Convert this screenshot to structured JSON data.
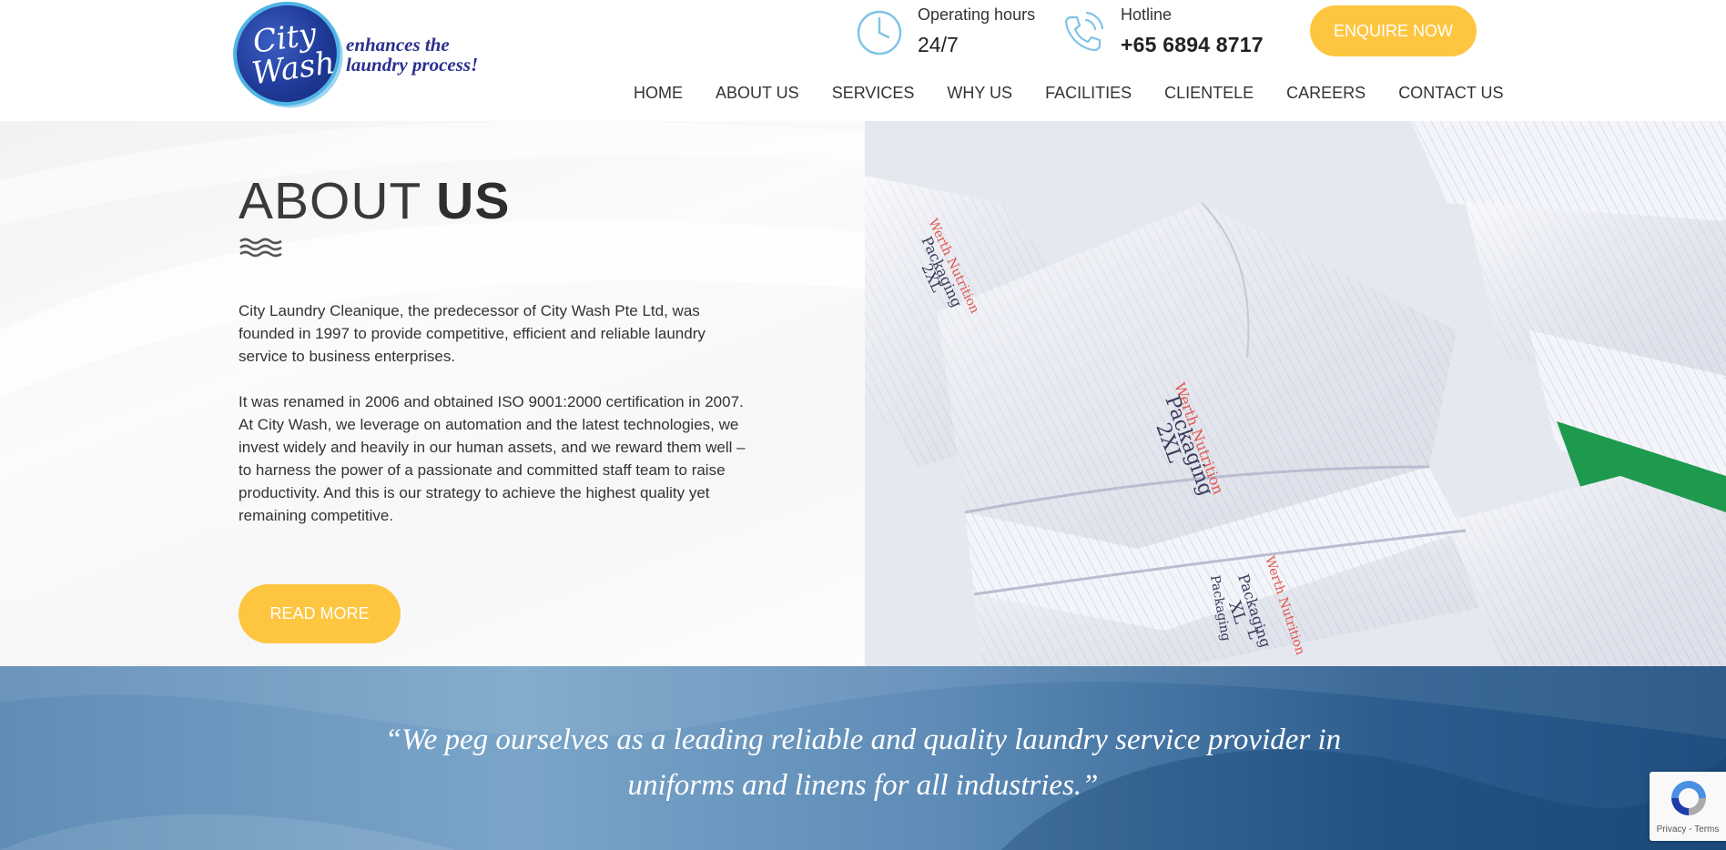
{
  "header": {
    "logo": {
      "badge_line1": "City",
      "badge_line2": "Wash",
      "tagline_line1": "enhances the",
      "tagline_line2": "laundry process!"
    },
    "operating_hours": {
      "icon": "clock-icon",
      "label": "Operating hours",
      "value": "24/7"
    },
    "hotline": {
      "icon": "phone-icon",
      "label": "Hotline",
      "value": "+65 6894 8717"
    },
    "enquire_label": "ENQUIRE NOW",
    "nav": [
      "HOME",
      "ABOUT US",
      "SERVICES",
      "WHY US",
      "FACILITIES",
      "CLIENTELE",
      "CAREERS",
      "CONTACT US"
    ]
  },
  "about": {
    "title_light": "ABOUT ",
    "title_bold": "US",
    "paragraphs": [
      "City Laundry Cleanique, the predecessor of City Wash Pte Ltd, was founded in 1997 to provide competitive, efficient and reliable laundry service to business enterprises.",
      "It was renamed in 2006 and obtained ISO 9001:2000 certification in 2007. At City Wash, we leverage on automation and the latest technologies, we invest widely and heavily in our human assets, and we reward them well – to harness the power of a passionate and committed staff team to raise productivity. And this is our strategy to achieve the highest quality yet remaining competitive."
    ],
    "read_more_label": "READ MORE",
    "photo_labels": [
      "Werth Nutrition",
      "Packaging",
      "2XL",
      "Werth Nutrition",
      "Packaging",
      "2XL",
      "Packaging",
      "XL",
      "Packaging",
      "L",
      "Werth Nutrition"
    ]
  },
  "quote": {
    "text": "“We peg ourselves as a leading reliable and quality laundry service provider in uniforms and linens for all industries.”"
  },
  "recaptcha": {
    "links": "Privacy - Terms"
  },
  "colors": {
    "accent": "#fec640",
    "brand_blue": "#1f3a98",
    "icon_blue": "#7ec4e6",
    "quote_bg": "#4a7aa6"
  }
}
